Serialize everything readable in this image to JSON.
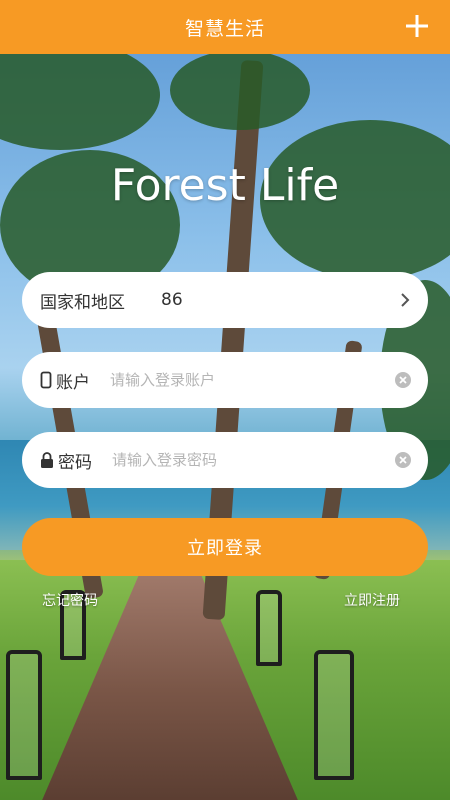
{
  "header": {
    "title": "智慧生活",
    "add_icon": "plus-icon"
  },
  "brand": {
    "title": "Forest Life"
  },
  "form": {
    "region": {
      "label": "国家和地区",
      "value": "86",
      "icon": "chevron-right-icon"
    },
    "account": {
      "label": "账户",
      "placeholder": "请输入登录账户",
      "icon": "phone-icon",
      "clear_icon": "clear-icon"
    },
    "password": {
      "label": "密码",
      "placeholder": "请输入登录密码",
      "icon": "lock-icon",
      "clear_icon": "clear-icon"
    },
    "login_label": "立即登录"
  },
  "links": {
    "forgot": "忘记密码",
    "register": "立即注册"
  },
  "colors": {
    "accent": "#f79a24",
    "field_bg": "#ffffff",
    "placeholder": "#b5b5b5"
  }
}
